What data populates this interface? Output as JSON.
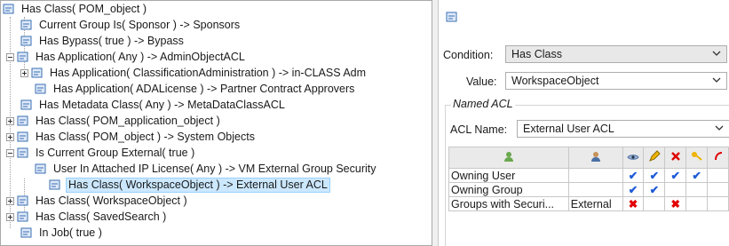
{
  "tree": {
    "items": [
      {
        "label": "Has Class( POM_object )",
        "expander": "minus"
      },
      {
        "label": "Current Group Is( Sponsor ) -> Sponsors",
        "expander": ""
      },
      {
        "label": "Has Bypass( true ) -> Bypass",
        "expander": ""
      },
      {
        "label": "Has Application( Any ) -> AdminObjectACL",
        "expander": "minus"
      },
      {
        "label": "Has Application( ClassificationAdministration ) -> in-CLASS Adm",
        "expander": "plus"
      },
      {
        "label": "Has Application( ADALicense ) -> Partner Contract Approvers",
        "expander": ""
      },
      {
        "label": "Has Metadata Class( Any ) -> MetaDataClassACL",
        "expander": ""
      },
      {
        "label": "Has Class( POM_application_object )",
        "expander": "plus"
      },
      {
        "label": "Has Class( POM_object ) -> System Objects",
        "expander": "plus"
      },
      {
        "label": "Is Current Group External( true )",
        "expander": "minus"
      },
      {
        "label": "User In Attached IP License( Any ) -> VM External Group Security",
        "expander": ""
      },
      {
        "label": "Has Class( WorkspaceObject ) -> External User ACL",
        "expander": "",
        "selected": true
      },
      {
        "label": "Has Class( WorkspaceObject )",
        "expander": "plus"
      },
      {
        "label": "Has Class( SavedSearch )",
        "expander": "plus"
      },
      {
        "label": "In Job( true )",
        "expander": ""
      }
    ]
  },
  "detail": {
    "condition_label": "Condition:",
    "condition_value": "Has Class",
    "value_label": "Value:",
    "value_value": "WorkspaceObject",
    "named_acl_title": "Named ACL",
    "acl_name_label": "ACL Name:",
    "acl_name_value": "External User ACL"
  },
  "acl_table": {
    "headers": [
      "",
      "",
      "",
      "",
      "",
      "",
      ""
    ],
    "header_icons": [
      "accessor-icon",
      "user-icon",
      "read-icon",
      "write-icon",
      "delete-icon",
      "change-icon",
      "more-icon"
    ],
    "rows": [
      {
        "accessor": "Owning User",
        "id": "",
        "perms": [
          "check",
          "check",
          "check",
          "check",
          ""
        ]
      },
      {
        "accessor": "Owning Group",
        "id": "",
        "perms": [
          "check",
          "check",
          "",
          "",
          ""
        ]
      },
      {
        "accessor": "Groups with Securi...",
        "id": "External",
        "perms": [
          "x",
          "",
          "x",
          "",
          ""
        ]
      }
    ]
  },
  "colors": {
    "selection": "#cce8ff",
    "check": "#1e5bd8",
    "deny": "#e00000"
  }
}
